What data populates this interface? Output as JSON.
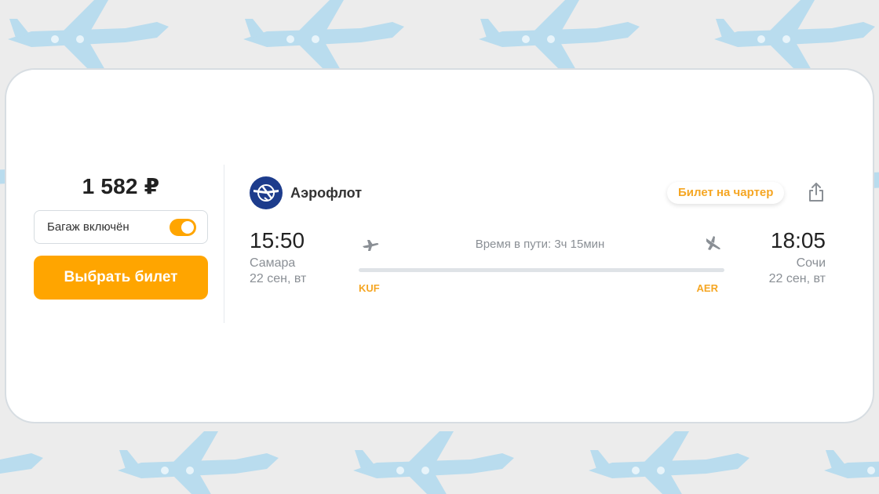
{
  "offer": {
    "price": "1 582 ₽",
    "baggage_label": "Багаж включён",
    "baggage_included": true,
    "select_button_label": "Выбрать билет"
  },
  "airline": {
    "name": "Аэрофлот",
    "logo_icon": "aeroflot-logo-icon"
  },
  "badge": {
    "label": "Билет на чартер"
  },
  "flight": {
    "departure": {
      "time": "15:50",
      "city": "Самара",
      "date": "22 сен, вт",
      "iata": "KUF"
    },
    "arrival": {
      "time": "18:05",
      "city": "Сочи",
      "date": "22 сен, вт",
      "iata": "AER"
    },
    "duration": "Время в пути: 3ч 15мин"
  },
  "icons": {
    "share": "share-icon",
    "takeoff": "takeoff-icon",
    "landing": "landing-icon",
    "background": "airplane-pattern"
  },
  "colors": {
    "accent": "#ffa500",
    "badge_text": "#f5a623",
    "background": "#ececec",
    "plane_pattern": "#b9dcee",
    "logo_blue": "#1d3c8c"
  }
}
